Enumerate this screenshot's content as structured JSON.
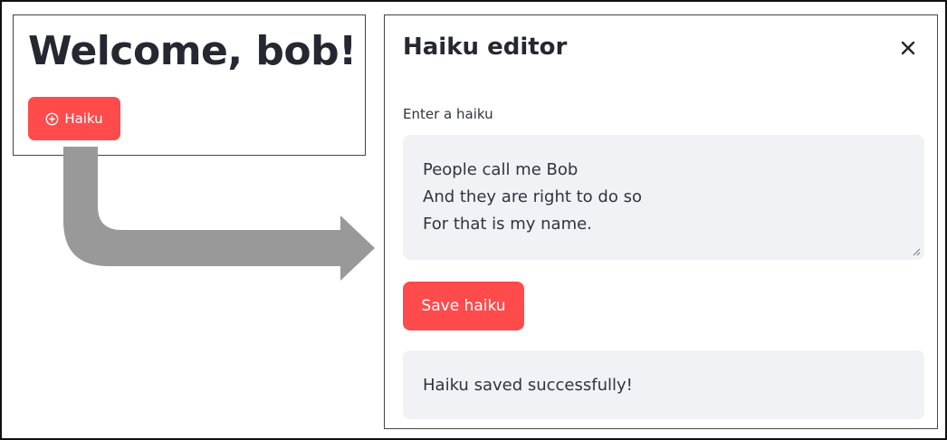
{
  "left_panel": {
    "welcome_heading": "Welcome, bob!",
    "haiku_button_label": "Haiku",
    "haiku_button_icon": "plus-circle-icon"
  },
  "arrow": {
    "color": "#999999"
  },
  "dialog": {
    "title": "Haiku editor",
    "close_icon": "close-icon",
    "field_label": "Enter a haiku",
    "haiku_value": "People call me Bob\nAnd they are right to do so\nFor that is my name.",
    "save_button_label": "Save haiku",
    "success_message": "Haiku saved successfully!"
  },
  "colors": {
    "accent": "#ff4b4b",
    "input_background": "#f0f2f6",
    "text": "#31333f"
  }
}
